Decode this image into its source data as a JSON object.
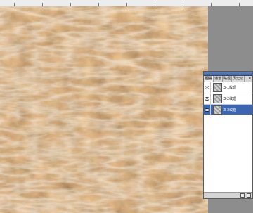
{
  "layers_panel": {
    "tabs": [
      {
        "label": "图层"
      },
      {
        "label": "通道"
      },
      {
        "label": "路径"
      },
      {
        "label": "历史记"
      }
    ],
    "close_label": "×",
    "layers": [
      {
        "name": "3-1纹理",
        "visible": true,
        "selected": false
      },
      {
        "name": "3-2纹理",
        "visible": true,
        "selected": false
      },
      {
        "name": "3-3纹理",
        "visible": true,
        "selected": true
      }
    ]
  },
  "colors": {
    "selection": "#3d66b0",
    "canvas_base": "#b07a50"
  }
}
